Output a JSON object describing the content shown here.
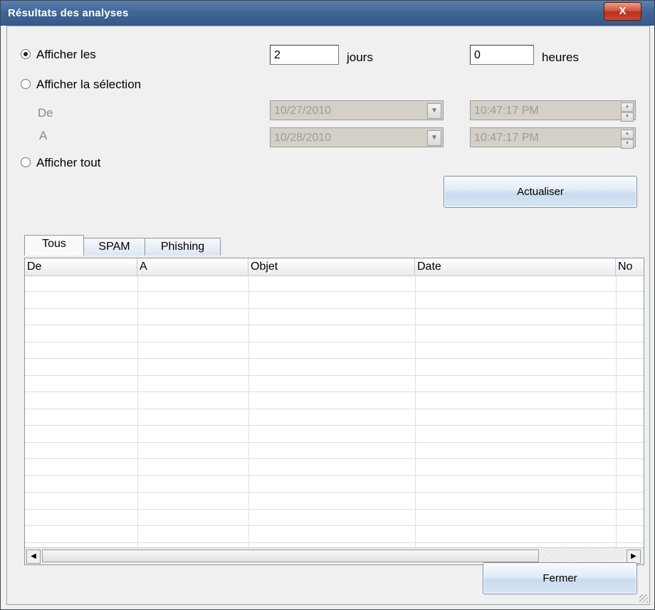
{
  "window": {
    "title": "Résultats des analyses",
    "close_label": "X"
  },
  "filter": {
    "show_last_label": "Afficher les",
    "show_selection_label": "Afficher la sélection",
    "from_label": "De",
    "to_label": "A",
    "show_all_label": "Afficher tout",
    "days_value": "2",
    "days_unit": "jours",
    "hours_value": "0",
    "hours_unit": "heures",
    "from_date": "10/27/2010",
    "to_date": "10/28/2010",
    "from_time": "10:47:17 PM",
    "to_time": "10:47:17 PM",
    "selected_option": "Afficher les"
  },
  "refresh_label": "Actualiser",
  "tabs": [
    {
      "label": "Tous",
      "active": true
    },
    {
      "label": "SPAM",
      "active": false
    },
    {
      "label": "Phishing",
      "active": false
    }
  ],
  "table": {
    "columns": [
      "De",
      "A",
      "Objet",
      "Date",
      "No"
    ],
    "rows": []
  },
  "close_button_label": "Fermer",
  "icons": [
    "close-icon",
    "dropdown-arrow-icon",
    "spin-up-icon",
    "spin-down-icon",
    "scroll-left-icon",
    "scroll-right-icon",
    "resize-grip-icon"
  ]
}
